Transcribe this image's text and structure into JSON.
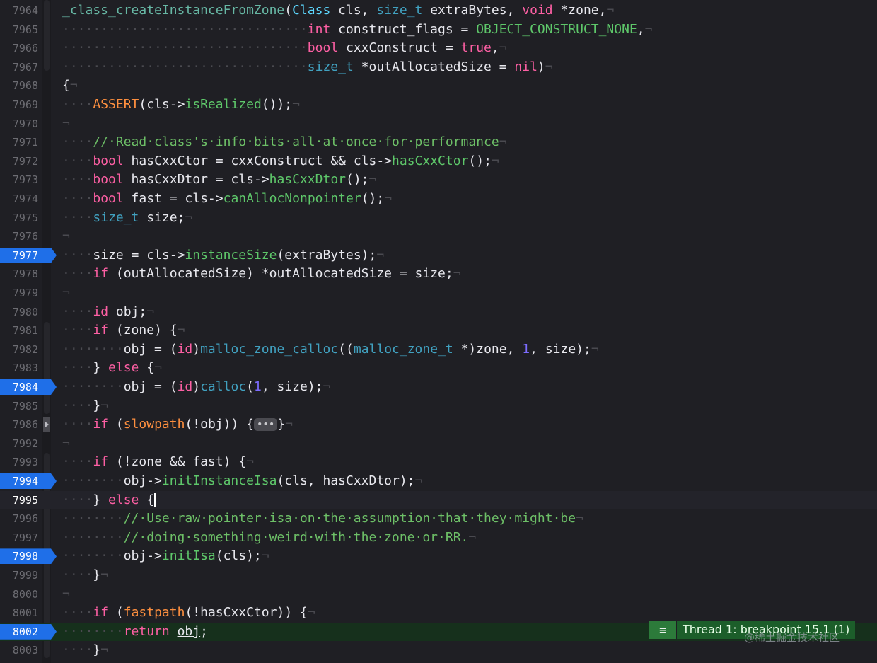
{
  "editor": {
    "lines": [
      {
        "no": "7964",
        "bp": false,
        "cur": false,
        "exec": false,
        "fold": false,
        "html": "<span class=\"fn\">_class_createInstanceFromZone</span>(<span class=\"ty\">Class</span> cls, <span class=\"ty2\">size_t</span> extraBytes, <span class=\"kw\">void</span> *zone,<span class=\"eol\">¬</span>"
      },
      {
        "no": "7965",
        "bp": false,
        "cur": false,
        "exec": false,
        "fold": false,
        "html": "<span class=\"ws\">································</span><span class=\"kw\">int</span> construct_flags = <span class=\"grn\">OBJECT_CONSTRUCT_NONE</span>,<span class=\"eol\">¬</span>"
      },
      {
        "no": "7966",
        "bp": false,
        "cur": false,
        "exec": false,
        "fold": false,
        "html": "<span class=\"ws\">································</span><span class=\"kw\">bool</span> cxxConstruct = <span class=\"kw\">true</span>,<span class=\"eol\">¬</span>"
      },
      {
        "no": "7967",
        "bp": false,
        "cur": false,
        "exec": false,
        "fold": false,
        "html": "<span class=\"ws\">································</span><span class=\"ty2\">size_t</span> *outAllocatedSize = <span class=\"kw\">nil</span>)<span class=\"eol\">¬</span>"
      },
      {
        "no": "7968",
        "bp": false,
        "cur": false,
        "exec": false,
        "fold": false,
        "html": "{<span class=\"eol\">¬</span>"
      },
      {
        "no": "7969",
        "bp": false,
        "cur": false,
        "exec": false,
        "fold": false,
        "html": "<span class=\"ws\">····</span><span class=\"mac\">ASSERT</span>(cls-&gt;<span class=\"mth\">isRealized</span>());<span class=\"eol\">¬</span>"
      },
      {
        "no": "7970",
        "bp": false,
        "cur": false,
        "exec": false,
        "fold": false,
        "html": "<span class=\"eol\">¬</span>"
      },
      {
        "no": "7971",
        "bp": false,
        "cur": false,
        "exec": false,
        "fold": false,
        "html": "<span class=\"ws\">····</span><span class=\"cm\">//·Read·class's·info·bits·all·at·once·for·performance</span><span class=\"eol\">¬</span>"
      },
      {
        "no": "7972",
        "bp": false,
        "cur": false,
        "exec": false,
        "fold": false,
        "html": "<span class=\"ws\">····</span><span class=\"kw\">bool</span> hasCxxCtor = cxxConstruct &amp;&amp; cls-&gt;<span class=\"mth\">hasCxxCtor</span>();<span class=\"eol\">¬</span>"
      },
      {
        "no": "7973",
        "bp": false,
        "cur": false,
        "exec": false,
        "fold": false,
        "html": "<span class=\"ws\">····</span><span class=\"kw\">bool</span> hasCxxDtor = cls-&gt;<span class=\"mth\">hasCxxDtor</span>();<span class=\"eol\">¬</span>"
      },
      {
        "no": "7974",
        "bp": false,
        "cur": false,
        "exec": false,
        "fold": false,
        "html": "<span class=\"ws\">····</span><span class=\"kw\">bool</span> fast = cls-&gt;<span class=\"mth\">canAllocNonpointer</span>();<span class=\"eol\">¬</span>"
      },
      {
        "no": "7975",
        "bp": false,
        "cur": false,
        "exec": false,
        "fold": false,
        "html": "<span class=\"ws\">····</span><span class=\"ty2\">size_t</span> size;<span class=\"eol\">¬</span>"
      },
      {
        "no": "7976",
        "bp": false,
        "cur": false,
        "exec": false,
        "fold": false,
        "html": "<span class=\"eol\">¬</span>"
      },
      {
        "no": "7977",
        "bp": true,
        "cur": false,
        "exec": false,
        "fold": false,
        "html": "<span class=\"ws\">····</span>size = cls-&gt;<span class=\"mth\">instanceSize</span>(extraBytes);<span class=\"eol\">¬</span>"
      },
      {
        "no": "7978",
        "bp": false,
        "cur": false,
        "exec": false,
        "fold": false,
        "html": "<span class=\"ws\">····</span><span class=\"kw\">if</span> (outAllocatedSize) *outAllocatedSize = size;<span class=\"eol\">¬</span>"
      },
      {
        "no": "7979",
        "bp": false,
        "cur": false,
        "exec": false,
        "fold": false,
        "html": "<span class=\"eol\">¬</span>"
      },
      {
        "no": "7980",
        "bp": false,
        "cur": false,
        "exec": false,
        "fold": false,
        "html": "<span class=\"ws\">····</span><span class=\"kw\">id</span> obj;<span class=\"eol\">¬</span>"
      },
      {
        "no": "7981",
        "bp": false,
        "cur": false,
        "exec": false,
        "fold": false,
        "html": "<span class=\"ws\">····</span><span class=\"kw\">if</span> (zone) {<span class=\"eol\">¬</span>"
      },
      {
        "no": "7982",
        "bp": false,
        "cur": false,
        "exec": false,
        "fold": false,
        "html": "<span class=\"ws\">········</span>obj = (<span class=\"kw\">id</span>)<span class=\"ty2\">malloc_zone_calloc</span>((<span class=\"ty2\">malloc_zone_t</span> *)zone, <span class=\"num-lit\" style=\"color:#7c6cff\">1</span>, size);<span class=\"eol\">¬</span>"
      },
      {
        "no": "7983",
        "bp": false,
        "cur": false,
        "exec": false,
        "fold": false,
        "html": "<span class=\"ws\">····</span>} <span class=\"kw\">else</span> {<span class=\"eol\">¬</span>"
      },
      {
        "no": "7984",
        "bp": true,
        "cur": false,
        "exec": false,
        "fold": false,
        "html": "<span class=\"ws\">········</span>obj = (<span class=\"kw\">id</span>)<span class=\"ty2\">calloc</span>(<span class=\"num-lit\" style=\"color:#7c6cff\">1</span>, size);<span class=\"eol\">¬</span>"
      },
      {
        "no": "7985",
        "bp": false,
        "cur": false,
        "exec": false,
        "fold": false,
        "html": "<span class=\"ws\">····</span>}<span class=\"eol\">¬</span>"
      },
      {
        "no": "7986",
        "bp": false,
        "cur": false,
        "exec": false,
        "fold": true,
        "html": "<span class=\"ws\">····</span><span class=\"kw\">if</span> (<span class=\"mac\">slowpath</span>(!obj)) {<span class=\"ell\">•••</span>}<span class=\"eol\">¬</span>"
      },
      {
        "no": "7992",
        "bp": false,
        "cur": false,
        "exec": false,
        "fold": false,
        "html": "<span class=\"eol\">¬</span>"
      },
      {
        "no": "7993",
        "bp": false,
        "cur": false,
        "exec": false,
        "fold": false,
        "html": "<span class=\"ws\">····</span><span class=\"kw\">if</span> (!zone &amp;&amp; fast) {<span class=\"eol\">¬</span>"
      },
      {
        "no": "7994",
        "bp": true,
        "cur": false,
        "exec": false,
        "fold": false,
        "html": "<span class=\"ws\">········</span>obj-&gt;<span class=\"mth\">initInstanceIsa</span>(cls, hasCxxDtor);<span class=\"eol\">¬</span>"
      },
      {
        "no": "7995",
        "bp": false,
        "cur": true,
        "exec": false,
        "fold": false,
        "html": "<span class=\"ws\">····</span>} <span class=\"kw\">else</span> {<span class=\"caret\"></span>"
      },
      {
        "no": "7996",
        "bp": false,
        "cur": false,
        "exec": false,
        "fold": false,
        "html": "<span class=\"ws\">········</span><span class=\"cm\">//·Use·raw·pointer·isa·on·the·assumption·that·they·might·be</span><span class=\"eol\">¬</span>"
      },
      {
        "no": "7997",
        "bp": false,
        "cur": false,
        "exec": false,
        "fold": false,
        "html": "<span class=\"ws\">········</span><span class=\"cm\">//·doing·something·weird·with·the·zone·or·RR.</span><span class=\"eol\">¬</span>"
      },
      {
        "no": "7998",
        "bp": true,
        "cur": false,
        "exec": false,
        "fold": false,
        "html": "<span class=\"ws\">········</span>obj-&gt;<span class=\"mth\">initIsa</span>(cls);<span class=\"eol\">¬</span>"
      },
      {
        "no": "7999",
        "bp": false,
        "cur": false,
        "exec": false,
        "fold": false,
        "html": "<span class=\"ws\">····</span>}<span class=\"eol\">¬</span>"
      },
      {
        "no": "8000",
        "bp": false,
        "cur": false,
        "exec": false,
        "fold": false,
        "html": "<span class=\"eol\">¬</span>"
      },
      {
        "no": "8001",
        "bp": false,
        "cur": false,
        "exec": false,
        "fold": false,
        "html": "<span class=\"ws\">····</span><span class=\"kw\">if</span> (<span class=\"mac\">fastpath</span>(!hasCxxCtor)) {<span class=\"eol\">¬</span>"
      },
      {
        "no": "8002",
        "bp": true,
        "cur": false,
        "exec": true,
        "fold": false,
        "html": "<span class=\"ws\">········</span><span class=\"kw\">return</span> <span class=\"ul\">obj</span>;"
      },
      {
        "no": "8003",
        "bp": false,
        "cur": false,
        "exec": false,
        "fold": false,
        "html": "<span class=\"ws\">····</span>}<span class=\"eol\">¬</span>"
      }
    ]
  },
  "debugger": {
    "banner_text": "Thread 1: breakpoint 15.1 (1)",
    "menu_icon": "≡"
  },
  "watermark": "@稀土掘金技术社区",
  "colors": {
    "background": "#1f1f24",
    "breakpoint": "#1f6fe8",
    "exec_line": "#16301c",
    "banner": "#1c5e2a"
  }
}
